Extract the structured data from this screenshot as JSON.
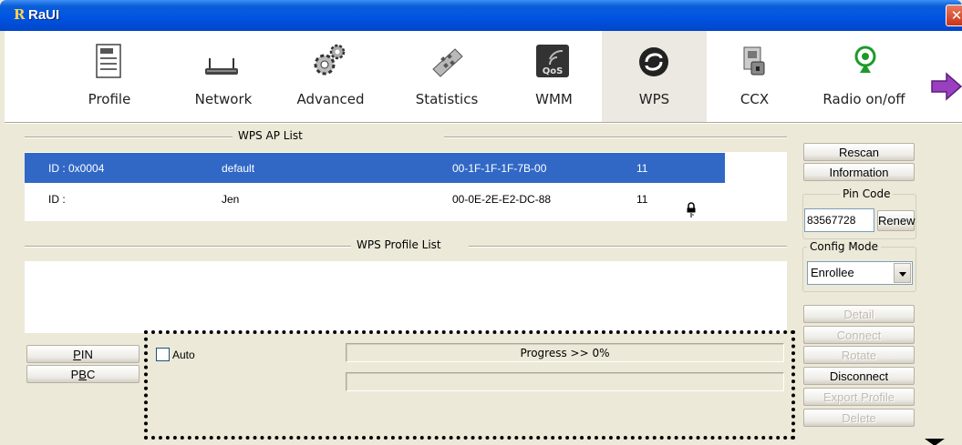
{
  "window": {
    "title": "RaUI",
    "logo": "R",
    "close_glyph": "✕"
  },
  "toolbar": {
    "items": [
      {
        "label": "Profile",
        "icon": "profile-icon"
      },
      {
        "label": "Network",
        "icon": "network-icon"
      },
      {
        "label": "Advanced",
        "icon": "advanced-icon"
      },
      {
        "label": "Statistics",
        "icon": "statistics-icon"
      },
      {
        "label": "WMM",
        "icon": "wmm-icon"
      },
      {
        "label": "WPS",
        "icon": "wps-icon",
        "selected": true
      },
      {
        "label": "CCX",
        "icon": "ccx-icon"
      },
      {
        "label": "Radio on/off",
        "icon": "radio-icon"
      }
    ],
    "next_icon": "next-arrow-icon",
    "wmm_badge": "QoS"
  },
  "ap_list": {
    "title": "WPS AP List",
    "rows": [
      {
        "id": "ID : 0x0004",
        "ssid": "default",
        "bssid": "00-1F-1F-1F-7B-00",
        "channel": "11",
        "selected": true
      },
      {
        "id": "ID :",
        "ssid": "Jen",
        "bssid": "00-0E-2E-E2-DC-88",
        "channel": "11",
        "locked": true
      }
    ]
  },
  "profile_list": {
    "title": "WPS Profile List",
    "rows": []
  },
  "side_panel": {
    "rescan": "Rescan",
    "information": "Information",
    "pin_code": {
      "caption": "Pin Code",
      "value": "83567728",
      "renew": "Renew"
    },
    "config_mode": {
      "caption": "Config Mode",
      "selected": "Enrollee"
    },
    "detail": "Detail",
    "connect": "Connect",
    "rotate": "Rotate",
    "disconnect": "Disconnect",
    "export_profile": "Export Profile",
    "delete": "Delete"
  },
  "actions": {
    "pin": {
      "mnemonic": "P",
      "rest": "IN"
    },
    "pbc": {
      "pre": "P",
      "mnemonic": "B",
      "rest": "C"
    }
  },
  "progress": {
    "auto_label": "Auto",
    "auto_checked": false,
    "text": "Progress >> 0%",
    "value": 0
  },
  "colors": {
    "selection": "#3168c6",
    "titlebar": "#0054e3",
    "window_bg": "#ece9d8"
  }
}
